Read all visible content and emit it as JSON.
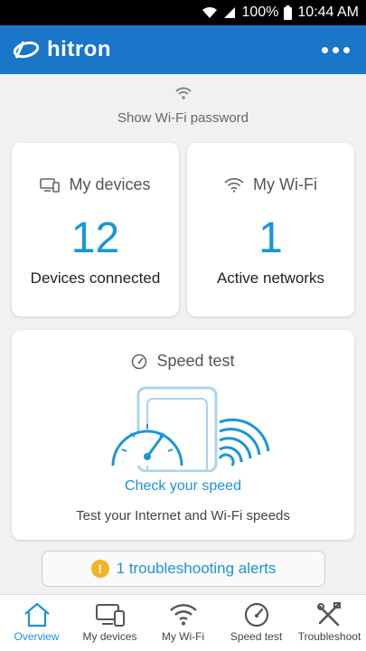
{
  "status_bar": {
    "battery": "100%",
    "time": "10:44 AM"
  },
  "app_bar": {
    "brand": "hitron"
  },
  "wifi_password": {
    "label": "Show Wi-Fi password"
  },
  "devices_card": {
    "title": "My devices",
    "count": "12",
    "subtitle": "Devices connected"
  },
  "wifi_card": {
    "title": "My Wi-Fi",
    "count": "1",
    "subtitle": "Active networks"
  },
  "speed_card": {
    "title": "Speed test",
    "action": "Check your speed",
    "subtitle": "Test your Internet and Wi-Fi speeds"
  },
  "alerts": {
    "icon": "!",
    "label": "1 troubleshooting alerts"
  },
  "bottom_nav": {
    "items": [
      {
        "label": "Overview",
        "icon": "home-icon",
        "active": true
      },
      {
        "label": "My devices",
        "icon": "devices-icon"
      },
      {
        "label": "My Wi-Fi",
        "icon": "wifi-icon"
      },
      {
        "label": "Speed test",
        "icon": "speedometer-icon"
      },
      {
        "label": "Troubleshoot",
        "icon": "tools-icon"
      }
    ]
  },
  "colors": {
    "primary": "#1976c8",
    "accent": "#1a95d8",
    "warning": "#f0b323",
    "background": "#f1f1f3"
  }
}
